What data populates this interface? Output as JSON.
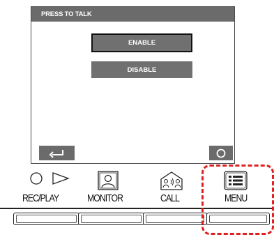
{
  "screen": {
    "title": "PRESS TO TALK",
    "options": {
      "enable": "ENABLE",
      "disable": "DISABLE"
    },
    "selected": "ENABLE",
    "soft_buttons": {
      "back_icon": "return-arrow-icon",
      "ok_icon": "circle-icon"
    }
  },
  "panel": {
    "rec_play": "REC/PLAY",
    "monitor": "MONITOR",
    "call": "CALL",
    "menu": "MENU"
  },
  "highlight_color": "#e02020"
}
